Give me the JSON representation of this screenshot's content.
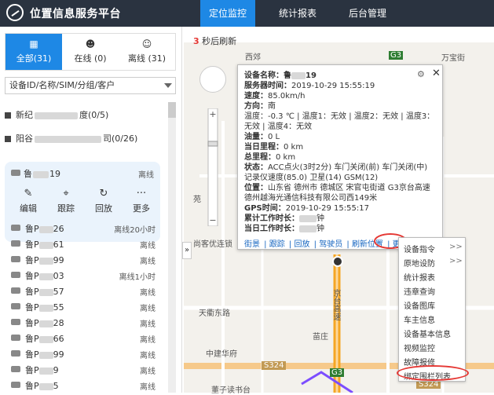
{
  "app": {
    "title": "位置信息服务平台",
    "logo_icon": "location-logo-icon"
  },
  "nav": [
    {
      "label": "定位监控",
      "active": true
    },
    {
      "label": "统计报表",
      "active": false
    },
    {
      "label": "后台管理",
      "active": false
    }
  ],
  "sidebar": {
    "tabs": [
      {
        "label": "全部(31)",
        "icon": "grid-icon",
        "active": true
      },
      {
        "label": "在线 (0)",
        "icon": "user-check-icon",
        "active": false
      },
      {
        "label": "离线 (31)",
        "icon": "user-offline-icon",
        "active": false
      }
    ],
    "search_placeholder": "设备ID/名称/SIM/分组/客户",
    "groups": [
      {
        "prefix": "新纪",
        "suffix": "度(0/5)"
      },
      {
        "prefix": "阳谷",
        "suffix": "司(0/26)"
      }
    ],
    "selected_vehicle": {
      "plate": "鲁",
      "plate_suffix": "19",
      "status": "离线",
      "actions": [
        {
          "label": "编辑",
          "icon": "edit-icon"
        },
        {
          "label": "跟踪",
          "icon": "crosshair-icon"
        },
        {
          "label": "回放",
          "icon": "replay-icon"
        },
        {
          "label": "更多",
          "icon": "more-icon"
        }
      ]
    },
    "vehicles": [
      {
        "plate": "鲁P",
        "suffix": "26",
        "status": "离线20小时"
      },
      {
        "plate": "鲁P",
        "suffix": "61",
        "status": "离线"
      },
      {
        "plate": "鲁P",
        "suffix": "99",
        "status": "离线"
      },
      {
        "plate": "鲁P",
        "suffix": "03",
        "status": "离线1小时"
      },
      {
        "plate": "鲁P",
        "suffix": "57",
        "status": "离线"
      },
      {
        "plate": "鲁P",
        "suffix": "55",
        "status": "离线"
      },
      {
        "plate": "鲁P",
        "suffix": "28",
        "status": "离线"
      },
      {
        "plate": "鲁P",
        "suffix": "66",
        "status": "离线"
      },
      {
        "plate": "鲁P",
        "suffix": "99",
        "status": "离线"
      },
      {
        "plate": "鲁P",
        "suffix": "9",
        "status": "离线"
      },
      {
        "plate": "鲁P",
        "suffix": "5",
        "status": "离线"
      }
    ]
  },
  "map": {
    "refresh_count": "3",
    "refresh_text": "秒后刷新",
    "labels": {
      "tianqu": "天衢东路",
      "zhongjian": "中建华府",
      "kaiyuan": "尚客优连锁",
      "jingtai": "京台高速",
      "s324a": "S324",
      "s324b": "S324",
      "g3a": "G3",
      "g3b": "G3",
      "wanbao": "万宝街",
      "miaozhuang": "苗庄",
      "xijiao": "西郊",
      "dongfang": "董子读书台",
      "yuan": "苑"
    },
    "popup": {
      "title_label": "设备名称：",
      "title_value": "鲁",
      "title_suffix": "19",
      "server_time_label": "服务器时间：",
      "server_time": "2019-10-29 15:55:19",
      "speed_label": "速度：",
      "speed": "85.0km/h",
      "direction_label": "方向：",
      "direction": "南",
      "temp_line1": "温度：-0.3 ℃ | 温度1：无效 | 温度2：无效 | 温度3：",
      "temp_line2": "无效 | 温度4：无效",
      "oil_label": "油量：",
      "oil": "0 L",
      "daily_mileage_label": "当日里程：",
      "daily_mileage": "0 km",
      "total_mileage_label": "总里程：",
      "total_mileage": "0 km",
      "status_label": "状态：",
      "status_line1": "ACC点火(3时2分) 车门关闭(前) 车门关闭(中)",
      "status_line2": "记录仪速度(85.0) 卫星(14) GSM(12)",
      "location_label": "位置：",
      "location_line1": "山东省 德州市 德城区 宋官屯街道 G3京台高速",
      "location_line2": "德州越海光通信科技有限公司西149米",
      "gps_time_label": "GPS时间：",
      "gps_time": "2019-10-29 15:55:17",
      "work_total_label": "累计工作时长：",
      "work_total": "钟",
      "work_today_label": "当日工作时长：",
      "work_today": "钟",
      "links": [
        "街景",
        "跟踪",
        "回放",
        "驾驶员",
        "刷新位置",
        "更多"
      ]
    },
    "more_menu": [
      {
        "label": "设备指令",
        "arrow": ">>"
      },
      {
        "label": "原地设防",
        "arrow": ">>"
      },
      {
        "label": "统计报表",
        "arrow": ""
      },
      {
        "label": "违章查询",
        "arrow": ""
      },
      {
        "label": "设备图库",
        "arrow": ""
      },
      {
        "label": "车主信息",
        "arrow": ""
      },
      {
        "label": "设备基本信息",
        "arrow": ""
      },
      {
        "label": "视频监控",
        "arrow": ""
      },
      {
        "label": "故障报修",
        "arrow": ""
      },
      {
        "label": "绑定围栏列表",
        "arrow": ""
      }
    ]
  },
  "colors": {
    "header": "#2a3340",
    "accent": "#1e88e5",
    "highlight": "#e53935",
    "route": "#f5a623"
  }
}
